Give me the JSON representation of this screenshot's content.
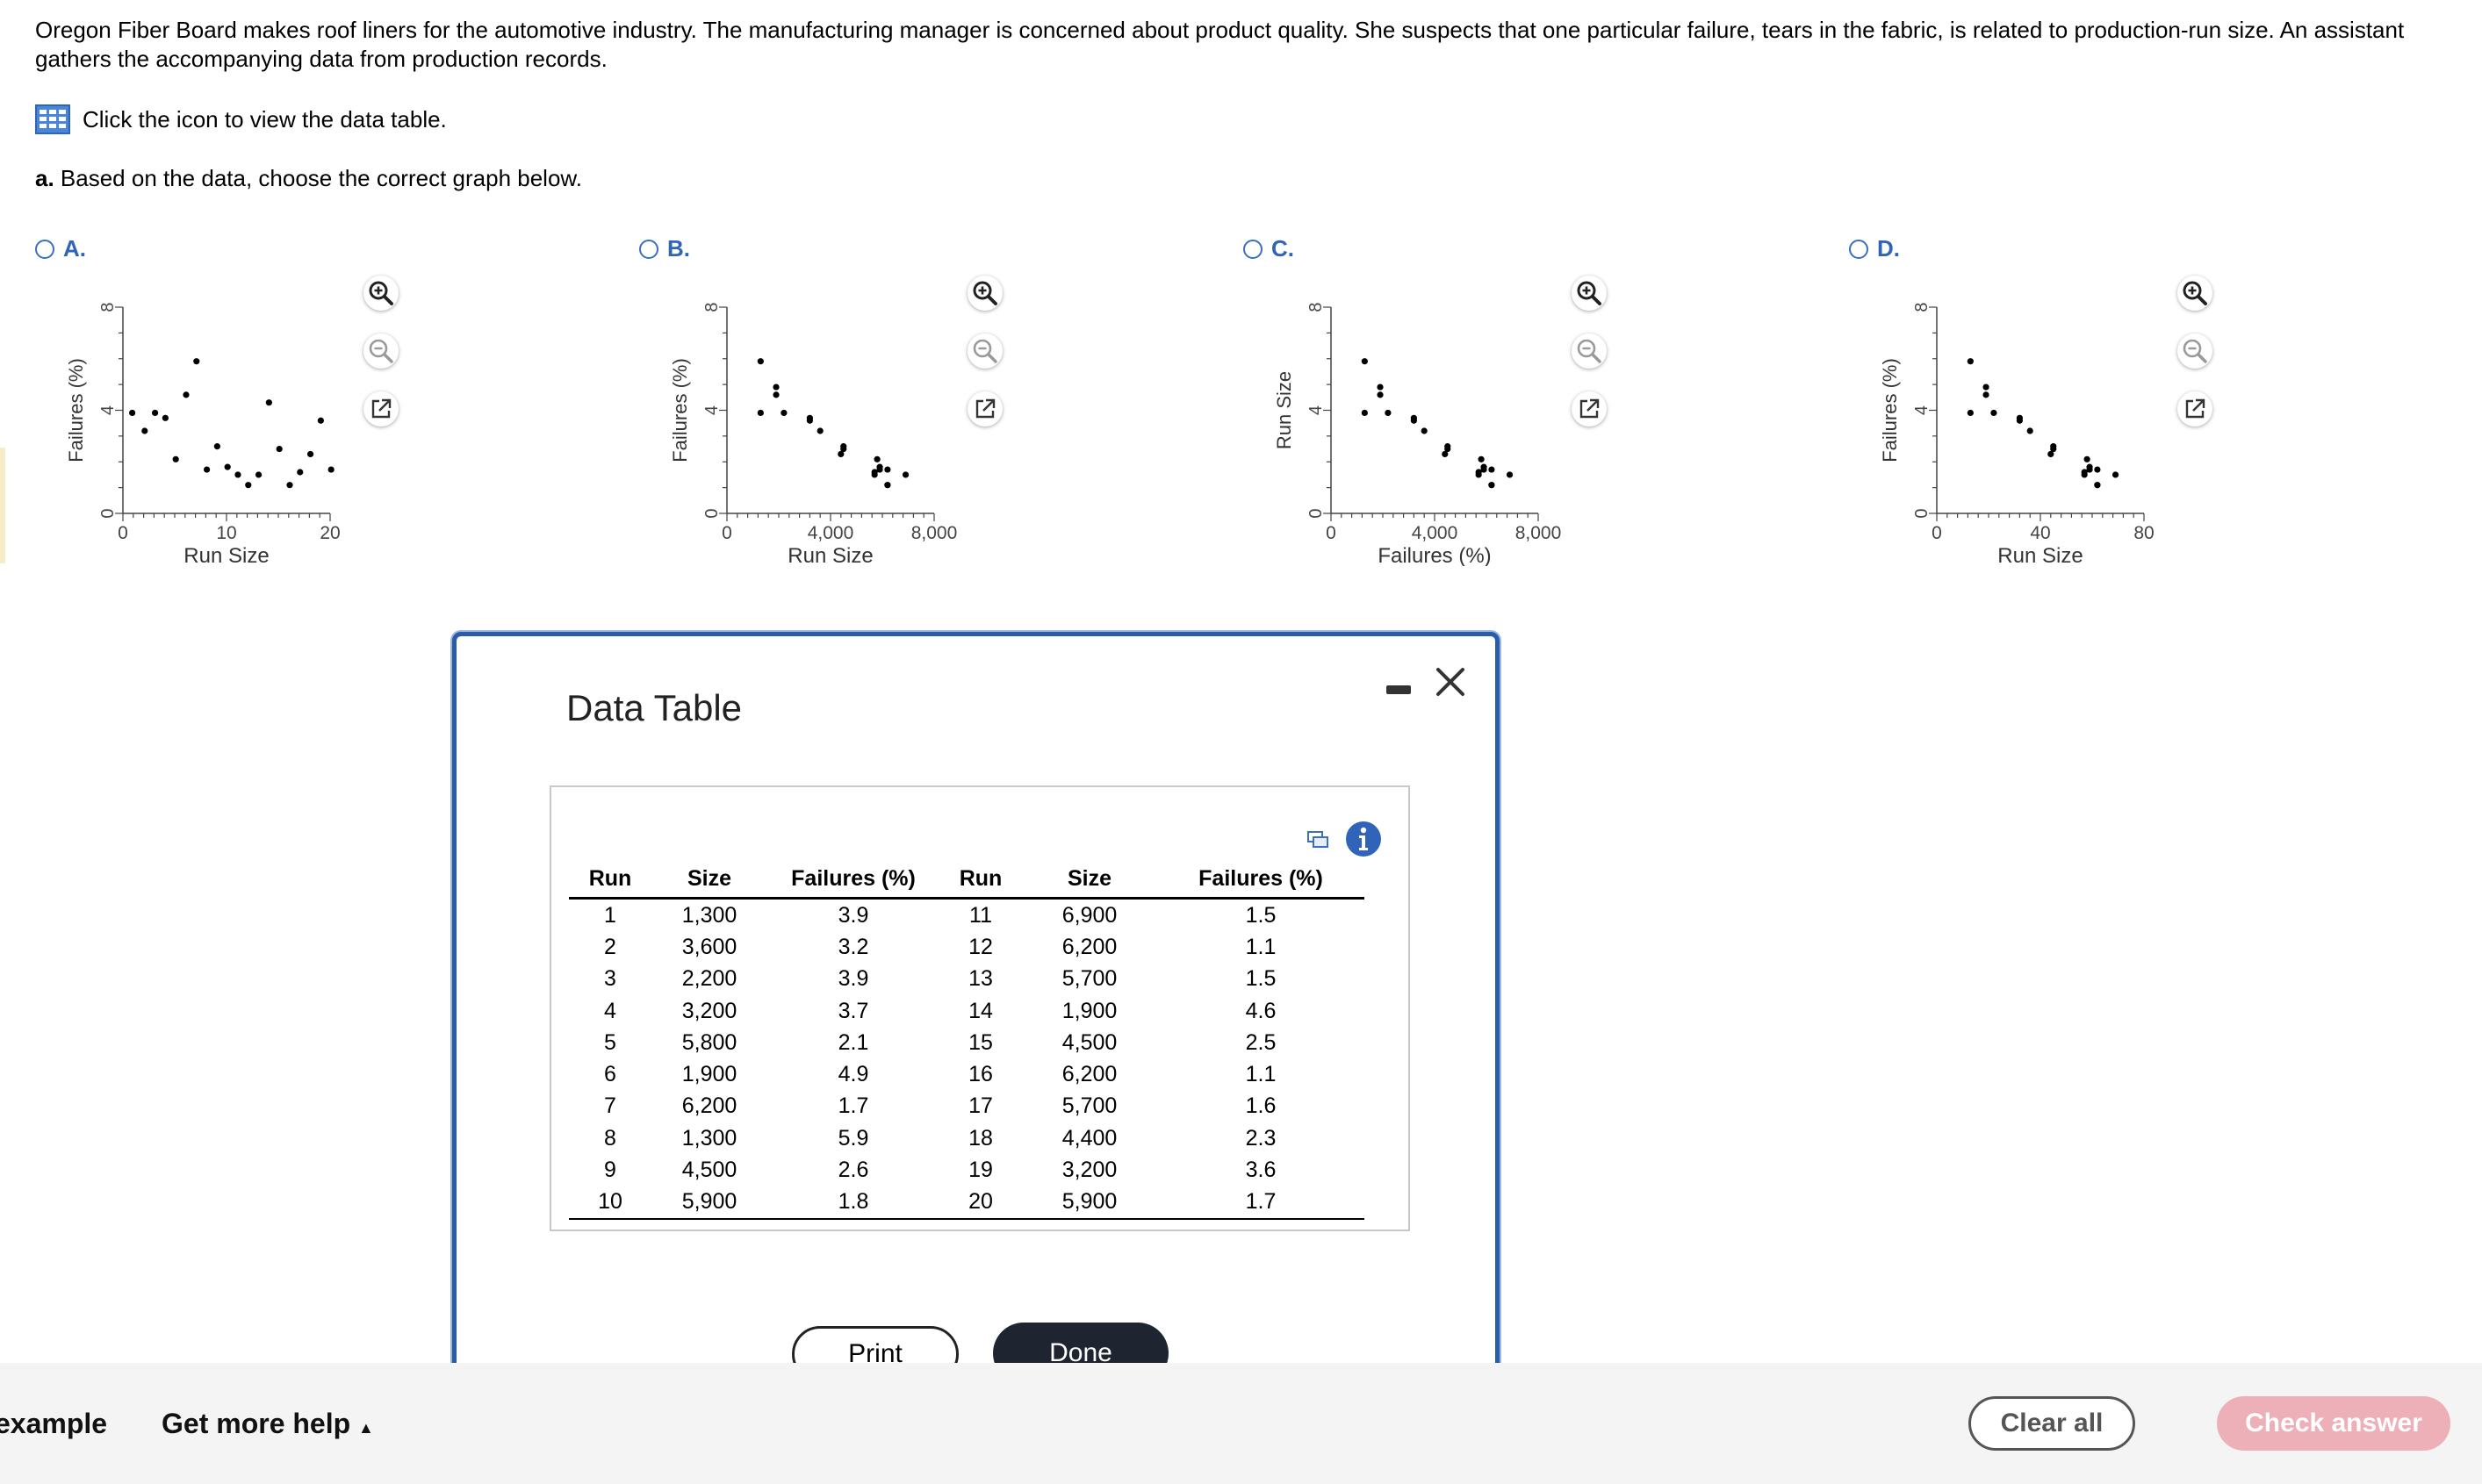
{
  "question": {
    "text": "Oregon Fiber Board makes roof liners for the automotive industry. The manufacturing manager is concerned about product quality. She suspects that one particular failure, tears in the fabric, is related to production-run size. An assistant gathers the accompanying data from production records.",
    "table_link": "Click the icon to view the data table.",
    "part_label": "a.",
    "part_text": " Based on the data, choose the correct graph below."
  },
  "options": [
    {
      "label": "A.",
      "ylabel": "Failures (%)",
      "xlabel": "Run Size",
      "yticks": [
        "0",
        "4",
        "8"
      ],
      "xticks": [
        "0",
        "10",
        "20"
      ]
    },
    {
      "label": "B.",
      "ylabel": "Failures (%)",
      "xlabel": "Run Size",
      "yticks": [
        "0",
        "4",
        "8"
      ],
      "xticks": [
        "0",
        "4,000",
        "8,000"
      ]
    },
    {
      "label": "C.",
      "ylabel": "Run Size",
      "xlabel": "Failures (%)",
      "yticks": [
        "0",
        "4",
        "8"
      ],
      "xticks": [
        "0",
        "4,000",
        "8,000"
      ]
    },
    {
      "label": "D.",
      "ylabel": "Failures (%)",
      "xlabel": "Run Size",
      "yticks": [
        "0",
        "4",
        "8"
      ],
      "xticks": [
        "0",
        "40",
        "80"
      ]
    }
  ],
  "chart_data": [
    {
      "type": "scatter",
      "xlabel": "Run Size",
      "ylabel": "Failures (%)",
      "xlim": [
        0,
        20
      ],
      "ylim": [
        0,
        8
      ],
      "points": [
        [
          0.9,
          3.9
        ],
        [
          2.1,
          3.2
        ],
        [
          3.1,
          3.9
        ],
        [
          4.1,
          3.7
        ],
        [
          5.1,
          2.1
        ],
        [
          6.1,
          4.6
        ],
        [
          7.1,
          5.9
        ],
        [
          8.1,
          1.7
        ],
        [
          9.1,
          2.6
        ],
        [
          10.1,
          1.8
        ],
        [
          11.1,
          1.5
        ],
        [
          12.1,
          1.1
        ],
        [
          13.1,
          1.5
        ],
        [
          14.1,
          4.3
        ],
        [
          15.1,
          2.5
        ],
        [
          16.1,
          1.1
        ],
        [
          17.1,
          1.6
        ],
        [
          18.1,
          2.3
        ],
        [
          19.1,
          3.6
        ],
        [
          20.1,
          1.7
        ]
      ]
    },
    {
      "type": "scatter",
      "xlabel": "Run Size",
      "ylabel": "Failures (%)",
      "xlim": [
        0,
        8000
      ],
      "ylim": [
        0,
        8
      ],
      "points": [
        [
          1300,
          3.9
        ],
        [
          3600,
          3.2
        ],
        [
          2200,
          3.9
        ],
        [
          3200,
          3.7
        ],
        [
          5800,
          2.1
        ],
        [
          1900,
          4.9
        ],
        [
          6200,
          1.7
        ],
        [
          1300,
          5.9
        ],
        [
          4500,
          2.6
        ],
        [
          5900,
          1.8
        ],
        [
          6900,
          1.5
        ],
        [
          6200,
          1.1
        ],
        [
          5700,
          1.5
        ],
        [
          1900,
          4.6
        ],
        [
          4500,
          2.5
        ],
        [
          6200,
          1.1
        ],
        [
          5700,
          1.6
        ],
        [
          4400,
          2.3
        ],
        [
          3200,
          3.6
        ],
        [
          5900,
          1.7
        ]
      ]
    },
    {
      "type": "scatter",
      "xlabel": "Failures (%)",
      "ylabel": "Run Size",
      "xlim": [
        0,
        8000
      ],
      "ylim": [
        0,
        8
      ],
      "points": [
        [
          1300,
          3.9
        ],
        [
          3600,
          3.2
        ],
        [
          2200,
          3.9
        ],
        [
          3200,
          3.7
        ],
        [
          5800,
          2.1
        ],
        [
          1900,
          4.9
        ],
        [
          6200,
          1.7
        ],
        [
          1300,
          5.9
        ],
        [
          4500,
          2.6
        ],
        [
          5900,
          1.8
        ],
        [
          6900,
          1.5
        ],
        [
          6200,
          1.1
        ],
        [
          5700,
          1.5
        ],
        [
          1900,
          4.6
        ],
        [
          4500,
          2.5
        ],
        [
          6200,
          1.1
        ],
        [
          5700,
          1.6
        ],
        [
          4400,
          2.3
        ],
        [
          3200,
          3.6
        ],
        [
          5900,
          1.7
        ]
      ]
    },
    {
      "type": "scatter",
      "xlabel": "Run Size",
      "ylabel": "Failures (%)",
      "xlim": [
        0,
        80
      ],
      "ylim": [
        0,
        8
      ],
      "points": [
        [
          13,
          3.9
        ],
        [
          36,
          3.2
        ],
        [
          22,
          3.9
        ],
        [
          32,
          3.7
        ],
        [
          58,
          2.1
        ],
        [
          19,
          4.9
        ],
        [
          62,
          1.7
        ],
        [
          13,
          5.9
        ],
        [
          45,
          2.6
        ],
        [
          59,
          1.8
        ],
        [
          69,
          1.5
        ],
        [
          62,
          1.1
        ],
        [
          57,
          1.5
        ],
        [
          19,
          4.6
        ],
        [
          45,
          2.5
        ],
        [
          62,
          1.1
        ],
        [
          57,
          1.6
        ],
        [
          44,
          2.3
        ],
        [
          32,
          3.6
        ],
        [
          59,
          1.7
        ]
      ]
    }
  ],
  "dialog": {
    "title": "Data Table",
    "headers": [
      "Run",
      "Size",
      "Failures (%)",
      "Run",
      "Size",
      "Failures (%)"
    ],
    "rows": [
      [
        "1",
        "1,300",
        "3.9",
        "11",
        "6,900",
        "1.5"
      ],
      [
        "2",
        "3,600",
        "3.2",
        "12",
        "6,200",
        "1.1"
      ],
      [
        "3",
        "2,200",
        "3.9",
        "13",
        "5,700",
        "1.5"
      ],
      [
        "4",
        "3,200",
        "3.7",
        "14",
        "1,900",
        "4.6"
      ],
      [
        "5",
        "5,800",
        "2.1",
        "15",
        "4,500",
        "2.5"
      ],
      [
        "6",
        "1,900",
        "4.9",
        "16",
        "6,200",
        "1.1"
      ],
      [
        "7",
        "6,200",
        "1.7",
        "17",
        "5,700",
        "1.6"
      ],
      [
        "8",
        "1,300",
        "5.9",
        "18",
        "4,400",
        "2.3"
      ],
      [
        "9",
        "4,500",
        "2.6",
        "19",
        "3,200",
        "3.6"
      ],
      [
        "10",
        "5,900",
        "1.8",
        "20",
        "5,900",
        "1.7"
      ]
    ],
    "print_label": "Print",
    "done_label": "Done"
  },
  "footer": {
    "example_label": "example",
    "help_label": "Get more help",
    "clear_label": "Clear all",
    "check_label": "Check answer"
  },
  "colors": {
    "accent": "#2f64b8",
    "dialog_border": "#2a5caa",
    "done_bg": "#1e2530",
    "check_bg": "#eeb0b8"
  }
}
